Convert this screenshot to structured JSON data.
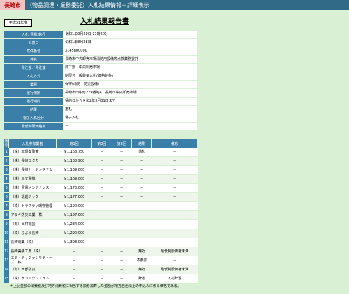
{
  "header": {
    "city": "長崎市",
    "title": "（物品調達・業務委託）入札結果情報－詳細表示"
  },
  "year_badge": "平成31年度",
  "page_title": "入札結果報告書",
  "info": [
    {
      "label": "入札(見積)執行",
      "value": "令和1年8月28日 11時20分"
    },
    {
      "label": "公表日",
      "value": "令和1年8月28日"
    },
    {
      "label": "案件番号",
      "value": "3145800000"
    },
    {
      "label": "件名",
      "value": "長崎市中央卸売市場消防用設備等点検業務委託"
    },
    {
      "label": "発注部／発注課",
      "value": "商工部　中央卸売市場"
    },
    {
      "label": "入札方式",
      "value": "制限付一般競争入札(価格競争)"
    },
    {
      "label": "業種",
      "value": "保守(消防・防災設備)"
    },
    {
      "label": "履行場所",
      "value": "長崎市田中町279番地4　長崎市中央卸売市場"
    },
    {
      "label": "履行期間",
      "value": "契約日から令和2年3月31日まで"
    },
    {
      "label": "結果",
      "value": "落札"
    },
    {
      "label": "電子入札区分",
      "value": "電子入札"
    },
    {
      "label": "最低制限価格率",
      "value": "－"
    }
  ],
  "bids_header": {
    "no": "番号",
    "name": "入札参加業者",
    "r1": "第1回",
    "r2": "第2回",
    "r3": "第3回",
    "result": "結果",
    "remarks": "備忘"
  },
  "bids": [
    {
      "no": "1",
      "name": "（株）城保安警備",
      "r1": "￥1,168,750",
      "r2": "－",
      "r3": "－",
      "result": "落札",
      "remarks": "－"
    },
    {
      "no": "2",
      "name": "（株）長崎ユタカ",
      "r1": "￥1,168,900",
      "r2": "－",
      "r3": "－",
      "result": "－",
      "remarks": "－"
    },
    {
      "no": "3",
      "name": "（株）長崎ガードシステム",
      "r1": "￥1,169,000",
      "r2": "－",
      "r3": "－",
      "result": "－",
      "remarks": "－"
    },
    {
      "no": "4",
      "name": "（株）三丈電機",
      "r1": "￥1,169,000",
      "r2": "－",
      "r3": "－",
      "result": "－",
      "remarks": "－"
    },
    {
      "no": "5",
      "name": "（株）青電メンテナンス",
      "r1": "￥1,175,000",
      "r2": "－",
      "r3": "－",
      "result": "－",
      "remarks": "－"
    },
    {
      "no": "6",
      "name": "（株）環創テック",
      "r1": "￥1,177,000",
      "r2": "－",
      "r3": "－",
      "result": "－",
      "remarks": "－"
    },
    {
      "no": "7",
      "name": "（株）トラスティ環物管理",
      "r1": "￥1,190,000",
      "r2": "－",
      "r3": "－",
      "result": "－",
      "remarks": "－"
    },
    {
      "no": "8",
      "name": "アラキ防災工業（株）",
      "r1": "￥1,197,000",
      "r2": "－",
      "r3": "－",
      "result": "－",
      "remarks": "－"
    },
    {
      "no": "9",
      "name": "（有）出村電設",
      "r1": "￥1,234,000",
      "r2": "－",
      "r3": "－",
      "result": "－",
      "remarks": "－"
    },
    {
      "no": "10",
      "name": "（株）ふよう長崎",
      "r1": "￥1,290,000",
      "r2": "－",
      "r3": "－",
      "result": "－",
      "remarks": "－"
    },
    {
      "no": "11",
      "name": "長崎電業（株）",
      "r1": "￥1,308,000",
      "r2": "－",
      "r3": "－",
      "result": "－",
      "remarks": "－"
    },
    {
      "no": "12",
      "name": "長崎美装工業（株）",
      "r1": "－",
      "r2": "－",
      "r3": "－",
      "result": "無効",
      "remarks": "最低制限価格未満"
    },
    {
      "no": "13",
      "name": "エヌ・ティファシリティーズ（株）",
      "r1": "－",
      "r2": "－",
      "r3": "－",
      "result": "不参加",
      "remarks": "－"
    },
    {
      "no": "14",
      "name": "（有）西部防災",
      "r1": "－",
      "r2": "－",
      "r3": "－",
      "result": "無効",
      "remarks": "最低制限価格未満"
    },
    {
      "no": "15",
      "name": "（株）サン・クリエイト",
      "r1": "－",
      "r2": "－",
      "r3": "－",
      "result": "辞退",
      "remarks": "入札辞退"
    }
  ],
  "note": "＊上記金額の消費税及び地方消費税に相当する額を加算した金額が地方自治法上の申込みに係る価格である。",
  "colors": {
    "header_bar": "#2f6a86",
    "label_bg": "#3b7fa8",
    "page_bg": "#d9f0d4",
    "city_bg": "#f3c2c2"
  }
}
